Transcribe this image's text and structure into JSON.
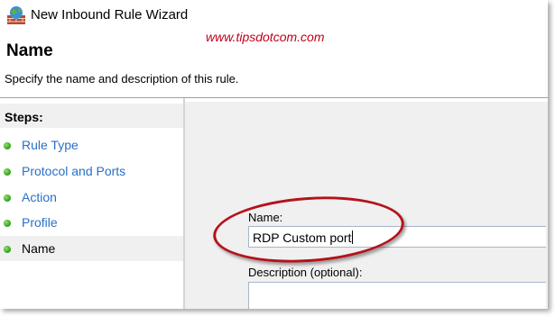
{
  "window": {
    "title": "New Inbound Rule Wizard",
    "icon": "firewall-globe-icon"
  },
  "watermark": "www.tipsdotcom.com",
  "page": {
    "title": "Name",
    "description": "Specify the name and description of this rule."
  },
  "steps": {
    "heading": "Steps:",
    "items": [
      {
        "label": "Rule Type",
        "status": "done"
      },
      {
        "label": "Protocol and Ports",
        "status": "done"
      },
      {
        "label": "Action",
        "status": "done"
      },
      {
        "label": "Profile",
        "status": "done"
      },
      {
        "label": "Name",
        "status": "current"
      }
    ]
  },
  "form": {
    "name_label": "Name:",
    "name_value": "RDP Custom port",
    "description_label": "Description (optional):",
    "description_value": ""
  },
  "colors": {
    "link_blue": "#2a6fc8",
    "step_dot_green": "#2f9b1e",
    "annotation_red": "#b5121b",
    "watermark_red": "#c0001a",
    "panel_gray": "#f0f0f0"
  }
}
